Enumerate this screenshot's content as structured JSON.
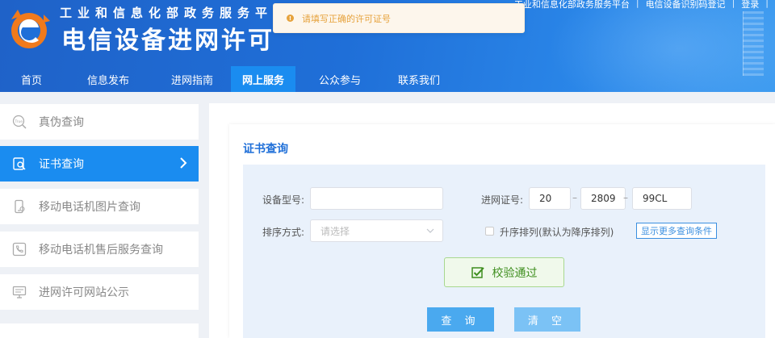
{
  "header": {
    "site_name": "工业和信息化部政务服务平台",
    "app_title": "电信设备进网许可",
    "top_links": [
      "工业和信息化部政务服务平台",
      "电信设备识别码登记",
      "登录"
    ],
    "nav": [
      {
        "label": "首页",
        "active": false
      },
      {
        "label": "信息发布",
        "active": false
      },
      {
        "label": "进网指南",
        "active": false
      },
      {
        "label": "网上服务",
        "active": true
      },
      {
        "label": "公众参与",
        "active": false
      },
      {
        "label": "联系我们",
        "active": false
      }
    ]
  },
  "toast": {
    "message": "请填写正确的许可证号",
    "type": "warning"
  },
  "sidebar": {
    "items": [
      {
        "label": "真伪查询",
        "icon": "true-badge-icon",
        "active": false
      },
      {
        "label": "证书查询",
        "icon": "certificate-search-icon",
        "active": true
      },
      {
        "label": "移动电话机图片查询",
        "icon": "phone-image-icon",
        "active": false
      },
      {
        "label": "移动电话机售后服务查询",
        "icon": "phone-service-icon",
        "active": false
      },
      {
        "label": "进网许可网站公示",
        "icon": "website-notice-icon",
        "active": false
      }
    ]
  },
  "main": {
    "title": "证书查询",
    "form": {
      "device_model_label": "设备型号:",
      "device_model_value": "",
      "license_label": "进网证号:",
      "license_parts": [
        "20",
        "2809",
        "99CL"
      ],
      "sort_label": "排序方式:",
      "sort_placeholder": "请选择",
      "ascending_label": "升序排列(默认为降序排列)",
      "ascending_checked": false,
      "more_conditions_label": "显示更多查询条件"
    },
    "verify_status": "校验通过",
    "buttons": {
      "query": "查 询",
      "clear": "清 空"
    }
  },
  "colors": {
    "primary": "#1a8cf0",
    "header": "#1f6fd8",
    "warning": "#e6a23c",
    "success": "#3e8e1e",
    "form_bg": "#e9f1fb"
  }
}
